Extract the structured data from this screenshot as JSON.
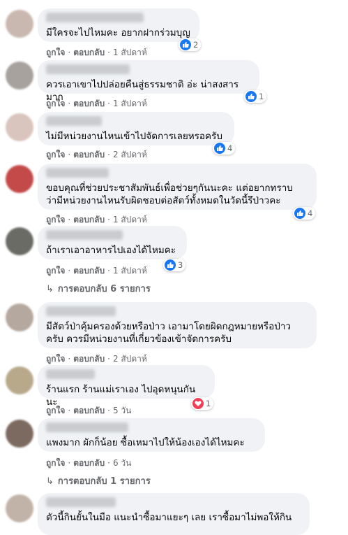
{
  "labels": {
    "like": "ถูกใจ",
    "reply": "ตอบกลับ",
    "dot": "·"
  },
  "comments": [
    {
      "text": "มีใครจะไปไหมคะ อยากฝากร่วมบุญ",
      "time": "1 สัปดาห์",
      "reaction": {
        "type": "like",
        "count": "2"
      }
    },
    {
      "text": "ควรเอาเขาไปปล่อยคืนสู่ธรรมชาติ อ่ะ น่าสงสารมาก",
      "time": "1 สัปดาห์",
      "reaction": {
        "type": "like",
        "count": "1"
      }
    },
    {
      "text": "ไม่มีหน่วยงานไหนเข้าไปจัดการเลยหรอครับ",
      "time": "2 สัปดาห์",
      "reaction": {
        "type": "like",
        "count": "4"
      }
    },
    {
      "text": "ขอบคุณที่ช่วยประชาสัมพันธ์เพื่อช่วยๆกันนะคะ แต่อยากทราบ\nว่ามีหน่วยงานไหนรับผิดชอบต่อสัตว์ทั้งหมดในวัดนี้รึป่าวคะ",
      "time": "1 สัปดาห์",
      "reaction": {
        "type": "like",
        "count": "4"
      }
    },
    {
      "text": "ถ้าเราเอาอาหารไปเองได้ไหมคะ",
      "time": "1 สัปดาห์",
      "reaction": {
        "type": "like",
        "count": "3"
      },
      "replies": "การตอบกลับ 6 รายการ"
    },
    {
      "text": "มีสัตว์ป่าคุ้มครองด้วยหรือป่าว เอามาโดยผิดกฎหมายหรือป่าว\nครับ ควรมีหน่วยงานที่เกี่ยวข้องเข้าจัดการครับ",
      "time": "2 สัปดาห์"
    },
    {
      "text": "ร้านแรก ร้านแม่เราเอง ไปอุดหนุนกันนะ",
      "time": "5 วัน",
      "reaction": {
        "type": "heart",
        "count": "1"
      }
    },
    {
      "text": "แพงมาก ผักก็น้อย ซื้อเหมาไปให้น้องเองได้ไหมคะ",
      "time": "6 วัน",
      "replies": "การตอบกลับ 1 รายการ"
    },
    {
      "text": "ตัวนี้กินยั้นในมือ แนะนำซื้อมาแยะๆ เลย เราซื้อมาไม่พอให้กิน",
      "time": ""
    }
  ],
  "colors": {
    "like": "#1877f2",
    "heart": "#f33e58",
    "bubble": "#f0f2f5",
    "meta": "#65676b"
  },
  "icons": {
    "like": "thumbs-up-icon",
    "heart": "heart-icon",
    "reply_arrow": "reply-arrow-icon"
  }
}
